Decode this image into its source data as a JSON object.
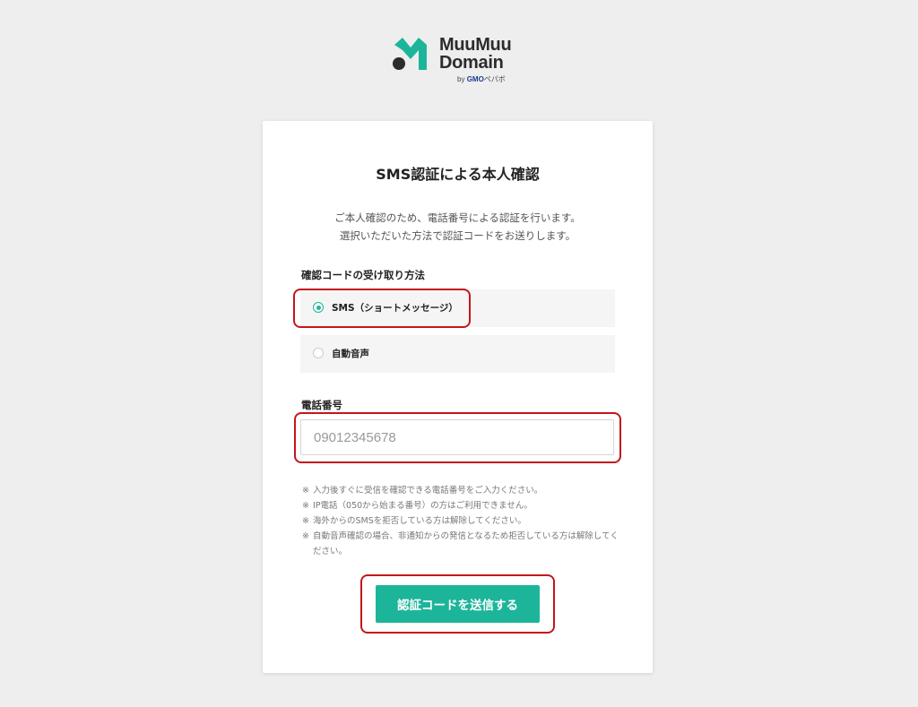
{
  "logo": {
    "line1": "MuuMuu",
    "line2": "Domain",
    "by": "by",
    "brand": "GMO",
    "brand_suffix": "ペパボ",
    "accent_color": "#1db59a"
  },
  "card": {
    "title": "SMS認証による本人確認",
    "description": [
      "ご本人確認のため、電話番号による認証を行います。",
      "選択いただいた方法で認証コードをお送りします。"
    ],
    "method_label": "確認コードの受け取り方法",
    "options": [
      {
        "label": "SMS（ショートメッセージ）",
        "selected": true
      },
      {
        "label": "自動音声",
        "selected": false
      }
    ],
    "phone_label": "電話番号",
    "phone_placeholder": "09012345678",
    "notes": [
      "入力後すぐに受信を確認できる電話番号をご入力ください。",
      "IP電話（050から始まる番号）の方はご利用できません。",
      "海外からのSMSを拒否している方は解除してください。",
      "自動音声確認の場合、非通知からの発信となるため拒否している方は解除してください。"
    ],
    "submit_label": "認証コードを送信する"
  },
  "highlight_color": "#c4161c"
}
